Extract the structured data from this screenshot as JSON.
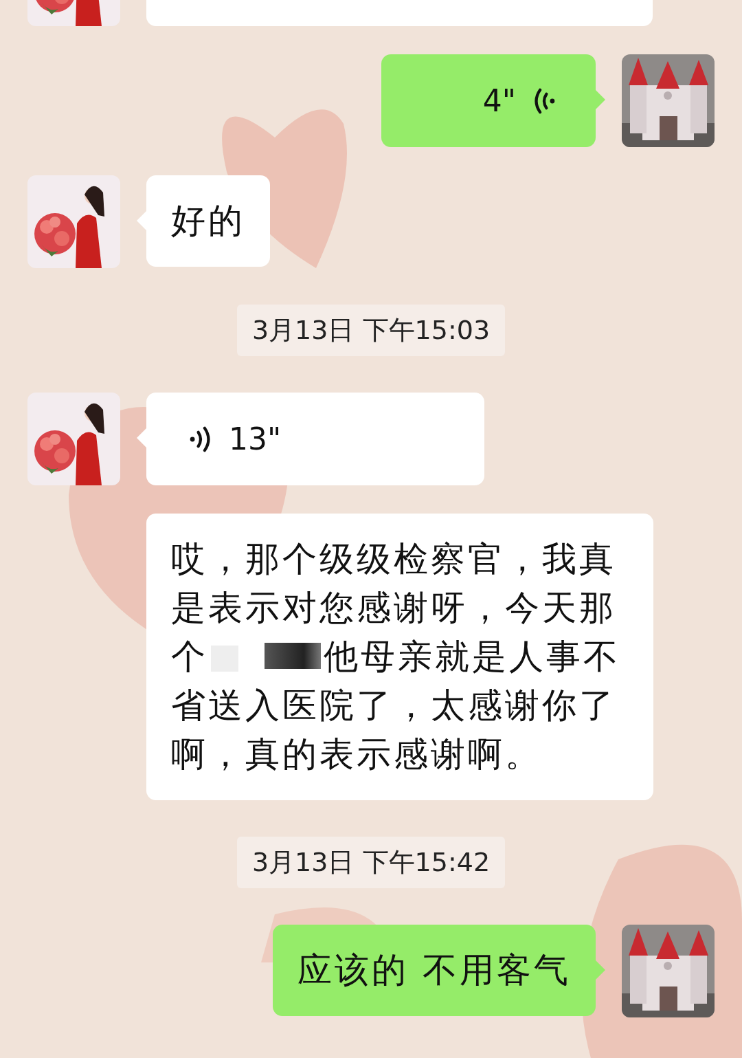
{
  "messages": [
    {
      "kind": "cut",
      "outgoing": false
    },
    {
      "kind": "voice",
      "outgoing": true,
      "avatar": true,
      "duration": "4\""
    },
    {
      "kind": "text",
      "outgoing": false,
      "avatar": true,
      "lines": [
        [
          {
            "kind": "text",
            "text": "好的"
          }
        ]
      ]
    },
    {
      "kind": "time",
      "text": "3月13日 下午15:03"
    },
    {
      "kind": "voice",
      "outgoing": false,
      "avatar": true,
      "duration": "13\""
    },
    {
      "kind": "text",
      "outgoing": false,
      "avatar": false,
      "lines": [
        [
          {
            "kind": "text",
            "text": "哎，那个级级检察官，我真是表示对您感谢呀，今天那"
          }
        ],
        [
          {
            "kind": "text",
            "text": "个"
          },
          {
            "kind": "redaction"
          },
          {
            "kind": "text",
            "text": "他母亲就是人事不"
          }
        ],
        [
          {
            "kind": "text",
            "text": "省送入医院了，太感谢你了啊，真的表示感谢啊。"
          }
        ]
      ]
    },
    {
      "kind": "time",
      "text": "3月13日 下午15:42"
    },
    {
      "kind": "text",
      "outgoing": true,
      "avatar": true,
      "lines": [
        [
          {
            "kind": "text",
            "text": "应该的 不用客气"
          }
        ]
      ]
    }
  ]
}
